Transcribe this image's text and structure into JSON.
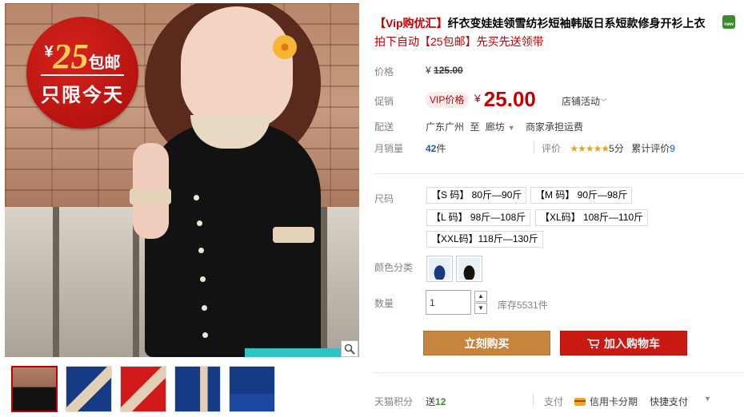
{
  "gallery": {
    "badge": {
      "yen": "¥",
      "amount": "25",
      "free_shipping": "包邮",
      "today_only": "只限今天"
    },
    "zoom_icon": "magnifier-icon",
    "thumbnails": [
      "thumb-1",
      "thumb-2",
      "thumb-3",
      "thumb-4",
      "thumb-5"
    ]
  },
  "product": {
    "title_vip": "【Vip购优汇】",
    "title_rest": "纤衣变娃娃领雪纺衫短袖韩版日系短款修身开衫上衣",
    "subtitle": "拍下自动【25包邮】先买先送领带",
    "new_badge": "new"
  },
  "price": {
    "label": "价格",
    "currency": "¥",
    "original": "125.00"
  },
  "promo": {
    "label": "促销",
    "vip_tag": "VIP价格",
    "currency": "¥",
    "price": "25.00",
    "shop_activity": "店铺活动"
  },
  "shipping": {
    "label": "配送",
    "from": "广东广州",
    "to_word": "至",
    "dest": "廊坊",
    "note": "商家承担运费"
  },
  "sales": {
    "label": "月销量",
    "count": "42",
    "unit": "件",
    "rating_label": "评价",
    "stars": "★★★★★",
    "score": "5分",
    "reviews_text": "累计评价",
    "reviews_count": "9"
  },
  "size": {
    "label": "尺码",
    "options": [
      "【S 码】 80斤—90斤",
      "【M 码】 90斤—98斤",
      "【L 码】 98斤—108斤",
      "【XL码】 108斤—110斤",
      "【XXL码】118斤—130斤"
    ]
  },
  "color": {
    "label": "颜色分类",
    "options": [
      "navy-blue",
      "black"
    ]
  },
  "quantity": {
    "label": "数量",
    "value": "1",
    "stock_text": "库存5531件"
  },
  "actions": {
    "buy_now": "立刻购买",
    "add_to_cart": "加入购物车"
  },
  "footer": {
    "points_label": "天猫积分",
    "points_give": "送",
    "points_value": "12",
    "pay_label": "支付",
    "credit_card": "信用卡分期",
    "quick_pay": "快捷支付"
  },
  "colors": {
    "accent_red": "#c40000",
    "buy_button": "#c6843d",
    "cart_button": "#c81913",
    "link_blue": "#1c5bb3"
  }
}
